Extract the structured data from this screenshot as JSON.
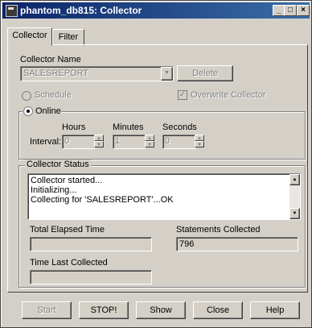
{
  "window": {
    "title": "phantom_db815: Collector"
  },
  "titlebar_buttons": {
    "minimize": "_",
    "maximize": "□",
    "close": "×"
  },
  "tabs": [
    {
      "label": "Collector"
    },
    {
      "label": "Filter"
    }
  ],
  "collector_name": {
    "label": "Collector Name",
    "value": "SALESREPORT",
    "delete_label": "Delete"
  },
  "schedule": {
    "label": "Schedule",
    "selected": false,
    "enabled": false
  },
  "overwrite": {
    "label": "Overwrite Collector",
    "checked": true,
    "enabled": false
  },
  "online": {
    "label": "Online",
    "selected": true,
    "interval_label": "Interval:",
    "hours": {
      "label": "Hours",
      "value": "0"
    },
    "minutes": {
      "label": "Minutes",
      "value": "1"
    },
    "seconds": {
      "label": "Seconds",
      "value": "0"
    }
  },
  "collector_status": {
    "label": "Collector Status",
    "lines": [
      "Collector started...",
      "Initializing...",
      "Collecting for 'SALESREPORT'...OK"
    ]
  },
  "total_elapsed": {
    "label": "Total Elapsed Time",
    "value": ""
  },
  "statements": {
    "label": "Statements Collected",
    "value": "796"
  },
  "time_last": {
    "label": "Time Last Collected",
    "value": ""
  },
  "buttons": {
    "start": "Start",
    "stop": "STOP!",
    "show": "Show",
    "close": "Close",
    "help": "Help"
  },
  "colors": {
    "titlebar": "#0a246a",
    "face": "#d4d0c8"
  }
}
